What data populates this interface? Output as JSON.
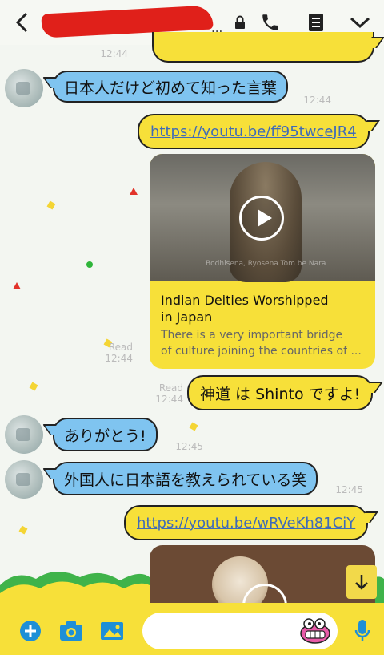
{
  "header": {
    "title_suffix": "...",
    "icons": [
      "back-icon",
      "lock-icon",
      "phone-icon",
      "menu-icon",
      "chevron-down-icon"
    ]
  },
  "messages": {
    "top_time": "12:44",
    "m1": {
      "text": "日本人だけど初めて知った言葉",
      "time": "12:44"
    },
    "m2": {
      "link": "https://youtu.be/ff95twceJR4"
    },
    "card": {
      "title_line1": "Indian Deities Worshipped",
      "title_line2": "in Japan",
      "desc_line1": "There is a very important bridge",
      "desc_line2": "of culture joining the countries of ...",
      "thumb_caption": "Bodhisena, Ryosena Tom be Nara",
      "read": "Read",
      "time": "12:44"
    },
    "m3": {
      "text": "神道 は Shinto ですよ!",
      "read": "Read",
      "time": "12:44"
    },
    "m4": {
      "text": "ありがとう!",
      "time": "12:45"
    },
    "m5": {
      "text": "外国人に日本語を教えられている笑",
      "time": "12:45"
    },
    "m6": {
      "link": "https://youtu.be/wRVeKh81CiY"
    }
  },
  "input": {
    "placeholder": "",
    "icons": [
      "add-icon",
      "camera-icon",
      "image-icon",
      "sticker-icon",
      "microphone-icon"
    ]
  },
  "colors": {
    "bubble_in": "#7fc4f0",
    "bubble_out": "#f7e039",
    "accent_blue": "#1e8fd6",
    "link": "#3f6bb8"
  }
}
